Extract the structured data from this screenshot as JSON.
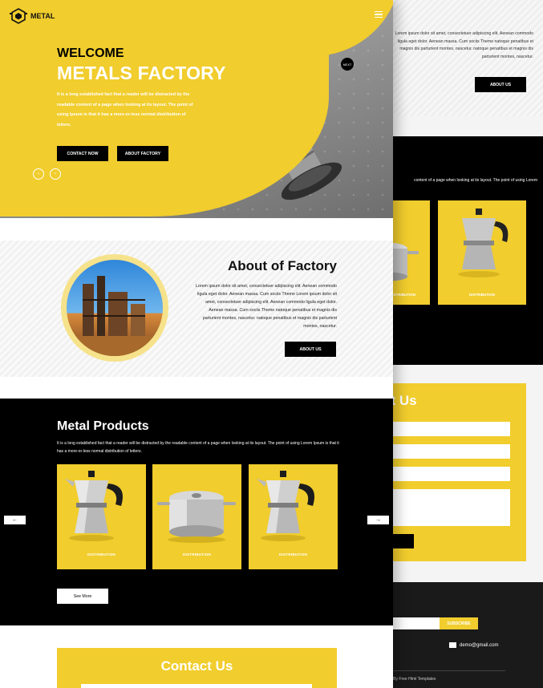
{
  "brand": {
    "name": "METAL",
    "accent": "#f1cd2d"
  },
  "hero": {
    "welcome": "WELCOME",
    "title": "METALS FACTORY",
    "description": "It is a long established fact that a reader will be distracted by the readable content of a page when looking at its layout. The point of using Ipsum is that it has a more-or-less normal distribution of letters.",
    "contact_label": "CONTACT NOW",
    "about_label": "ABOUT FACTORY",
    "prev_icon": "chevron-left-icon",
    "next_icon": "chevron-right-icon",
    "next_badge": "NEXT"
  },
  "about": {
    "title": "About of Factory",
    "text": "Lorem ipsum dolor sit amet, consectetuer adipiscing elit. Aenean commodo ligula eget dolor. Aenean massa. Cum sociis Theme Lorem ipsum dolor sit amet, consectetuer adipiscing elit. Aenean commodo ligula eget dolor. Aenean massa. Cum sociis Theme natoque penatibus et magnis dis parturient montes, nascetur. natoque penatibus et magnis dis parturient montes, nascetur.",
    "button_label": "ABOUT US"
  },
  "products": {
    "title": "Metal Products",
    "description": "It is a long established fact that a reader will be distracted by the readable content of a page when looking at its layout. The point of using Lorem Ipsum is that it has a more-or-less normal distribution of letters.",
    "items": [
      {
        "label": "DISTRIBUTION",
        "image": "moka-pot"
      },
      {
        "label": "DISTRIBUTION",
        "image": "cooking-pot"
      },
      {
        "label": "DISTRIBUTION",
        "image": "moka-pot"
      }
    ],
    "prev_arrow": "←",
    "next_arrow": "→",
    "see_more": "See More"
  },
  "contact": {
    "title": "Contact Us"
  },
  "back_page": {
    "about_text": "Lorem ipsum dolor sit amet, consectetuer adipiscing elit. Aenean commodo ligula eget dolor. Aenean massa. Cum sociis Theme natoque penatibus et magnis dis parturient montes, nascetur. natoque penatibus et magnis dis parturient montes, nascetur.",
    "about_button": "ABOUT US",
    "products_text": "content of a page when looking at its layout. The point of using Lorem",
    "product_label": "DISTRIBUTION",
    "contact_title": "ct Us",
    "subscribe_label": "SUBSCRIBE",
    "email": "demo@gmail.com",
    "copyright": "d By Free Html Templates"
  }
}
